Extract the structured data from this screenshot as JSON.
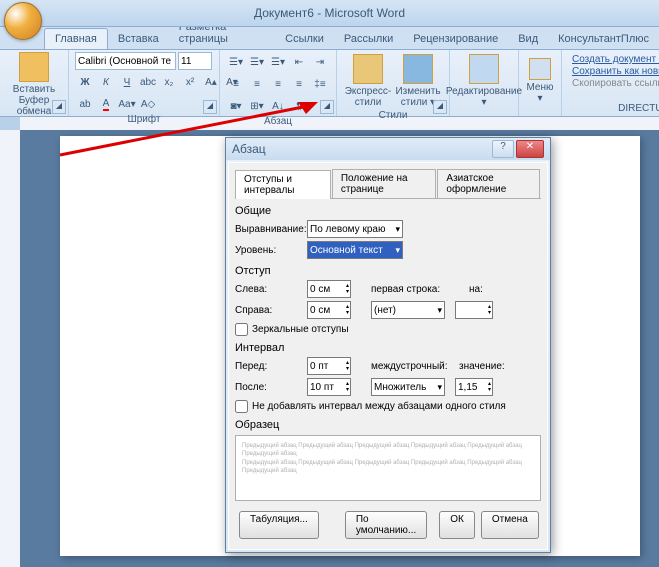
{
  "title": "Документ6 - Microsoft Word",
  "tabs": [
    "Главная",
    "Вставка",
    "Разметка страницы",
    "Ссылки",
    "Рассылки",
    "Рецензирование",
    "Вид",
    "КонсультантПлюс"
  ],
  "active_tab": 0,
  "ribbon": {
    "clipboard": {
      "label": "Буфер обмена",
      "paste": "Вставить"
    },
    "font": {
      "label": "Шрифт",
      "family": "Calibri (Основной те",
      "size": "11"
    },
    "paragraph": {
      "label": "Абзац"
    },
    "styles": {
      "label": "Стили",
      "express": "Экспресс-стили",
      "change": "Изменить стили ▾"
    },
    "editing": {
      "label": "Редактирование ▾"
    },
    "menu": {
      "label": "Меню ▾"
    },
    "directum": {
      "label": "DIRECTUM",
      "links": [
        "Создать документ из шаблона",
        "Сохранить как новый документ",
        "Скопировать ссылку в буфер"
      ]
    }
  },
  "dialog": {
    "title": "Абзац",
    "tabs": [
      "Отступы и интервалы",
      "Положение на странице",
      "Азиатское оформление"
    ],
    "active_tab": 0,
    "general": {
      "heading": "Общие",
      "align_label": "Выравнивание:",
      "align_value": "По левому краю",
      "level_label": "Уровень:",
      "level_value": "Основной текст"
    },
    "indent": {
      "heading": "Отступ",
      "left_label": "Слева:",
      "left_value": "0 см",
      "right_label": "Справа:",
      "right_value": "0 см",
      "first_label": "первая строка:",
      "first_value": "(нет)",
      "by_label": "на:",
      "by_value": "",
      "mirror": "Зеркальные отступы"
    },
    "spacing": {
      "heading": "Интервал",
      "before_label": "Перед:",
      "before_value": "0 пт",
      "after_label": "После:",
      "after_value": "10 пт",
      "line_label": "междустрочный:",
      "line_value": "Множитель",
      "at_label": "значение:",
      "at_value": "1,15",
      "noadd": "Не добавлять интервал между абзацами одного стиля"
    },
    "sample": {
      "heading": "Образец",
      "text": "Предыдущий абзац Предыдущий абзац Предыдущий абзац Предыдущий абзац Предыдущий абзац Предыдущий абзац"
    },
    "buttons": {
      "tabs": "Табуляция...",
      "default": "По умолчанию...",
      "ok": "ОК",
      "cancel": "Отмена"
    }
  }
}
